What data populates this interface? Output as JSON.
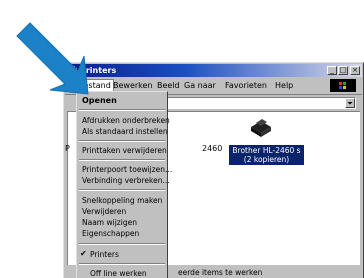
{
  "window": {
    "title": "Printers",
    "minimize": "_",
    "maximize": "□",
    "close": "×"
  },
  "menubar": {
    "items": [
      {
        "label": "Bestand"
      },
      {
        "label": "Bewerken"
      },
      {
        "label": "Beeld"
      },
      {
        "label": "Ga naar"
      },
      {
        "label": "Favorieten"
      },
      {
        "label": "Help"
      }
    ]
  },
  "content": {
    "left_letter": "P",
    "number_text": "2460",
    "printer_label_line1": "Brother HL-2460 s",
    "printer_label_line2": "(2 kopieren)"
  },
  "status": {
    "text": "eerde items te werken"
  },
  "dropdown": {
    "items": [
      {
        "label": "Openen"
      },
      {
        "label": "Afdrukken onderbreken"
      },
      {
        "label": "Als standaard instellen"
      },
      {
        "label": "Printtaken verwijderen"
      },
      {
        "label": "Printerpoort toewijzen..."
      },
      {
        "label": "Verbinding verbreken..."
      },
      {
        "label": "Snelkoppeling maken"
      },
      {
        "label": "Verwijderen"
      },
      {
        "label": "Naam wijzigen"
      },
      {
        "label": "Eigenschappen"
      },
      {
        "label": "Printers"
      },
      {
        "label": "Off line werken"
      }
    ],
    "check_mark": "✔"
  },
  "colors": {
    "pointer_arrow": "#1b82c8",
    "title_bar": "#0a1e8c",
    "selection": "#0a246a"
  }
}
